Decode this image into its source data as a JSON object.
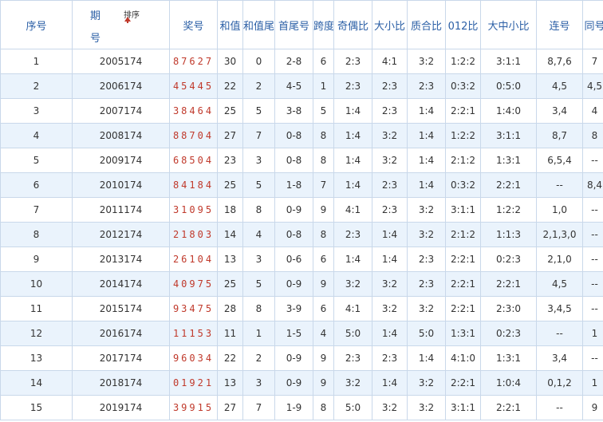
{
  "headers": {
    "index": "序号",
    "period_line1": "期",
    "period_line2": "号",
    "sort": "排序",
    "award": "奖号",
    "sum": "和值",
    "sum_tail": "和值尾",
    "first_last": "首尾号",
    "span": "跨度",
    "odd_even": "奇偶比",
    "big_small": "大小比",
    "prime_composite": "质合比",
    "mod012": "012比",
    "big_mid_small": "大中小比",
    "consecutive": "连号",
    "same": "同号"
  },
  "rows": [
    {
      "index": "1",
      "period": "2005174",
      "award": "87627",
      "sum": "30",
      "tail": "0",
      "first_last": "2-8",
      "span": "6",
      "odd_even": "2:3",
      "big_small": "4:1",
      "prime": "3:2",
      "mod012": "1:2:2",
      "bms": "3:1:1",
      "consec": "8,7,6",
      "same": "7"
    },
    {
      "index": "2",
      "period": "2006174",
      "award": "45445",
      "sum": "22",
      "tail": "2",
      "first_last": "4-5",
      "span": "1",
      "odd_even": "2:3",
      "big_small": "2:3",
      "prime": "2:3",
      "mod012": "0:3:2",
      "bms": "0:5:0",
      "consec": "4,5",
      "same": "4,5"
    },
    {
      "index": "3",
      "period": "2007174",
      "award": "38464",
      "sum": "25",
      "tail": "5",
      "first_last": "3-8",
      "span": "5",
      "odd_even": "1:4",
      "big_small": "2:3",
      "prime": "1:4",
      "mod012": "2:2:1",
      "bms": "1:4:0",
      "consec": "3,4",
      "same": "4"
    },
    {
      "index": "4",
      "period": "2008174",
      "award": "88704",
      "sum": "27",
      "tail": "7",
      "first_last": "0-8",
      "span": "8",
      "odd_even": "1:4",
      "big_small": "3:2",
      "prime": "1:4",
      "mod012": "1:2:2",
      "bms": "3:1:1",
      "consec": "8,7",
      "same": "8"
    },
    {
      "index": "5",
      "period": "2009174",
      "award": "68504",
      "sum": "23",
      "tail": "3",
      "first_last": "0-8",
      "span": "8",
      "odd_even": "1:4",
      "big_small": "3:2",
      "prime": "1:4",
      "mod012": "2:1:2",
      "bms": "1:3:1",
      "consec": "6,5,4",
      "same": "--"
    },
    {
      "index": "6",
      "period": "2010174",
      "award": "84184",
      "sum": "25",
      "tail": "5",
      "first_last": "1-8",
      "span": "7",
      "odd_even": "1:4",
      "big_small": "2:3",
      "prime": "1:4",
      "mod012": "0:3:2",
      "bms": "2:2:1",
      "consec": "--",
      "same": "8,4"
    },
    {
      "index": "7",
      "period": "2011174",
      "award": "31095",
      "sum": "18",
      "tail": "8",
      "first_last": "0-9",
      "span": "9",
      "odd_even": "4:1",
      "big_small": "2:3",
      "prime": "3:2",
      "mod012": "3:1:1",
      "bms": "1:2:2",
      "consec": "1,0",
      "same": "--"
    },
    {
      "index": "8",
      "period": "2012174",
      "award": "21803",
      "sum": "14",
      "tail": "4",
      "first_last": "0-8",
      "span": "8",
      "odd_even": "2:3",
      "big_small": "1:4",
      "prime": "3:2",
      "mod012": "2:1:2",
      "bms": "1:1:3",
      "consec": "2,1,3,0",
      "same": "--"
    },
    {
      "index": "9",
      "period": "2013174",
      "award": "26104",
      "sum": "13",
      "tail": "3",
      "first_last": "0-6",
      "span": "6",
      "odd_even": "1:4",
      "big_small": "1:4",
      "prime": "2:3",
      "mod012": "2:2:1",
      "bms": "0:2:3",
      "consec": "2,1,0",
      "same": "--"
    },
    {
      "index": "10",
      "period": "2014174",
      "award": "40975",
      "sum": "25",
      "tail": "5",
      "first_last": "0-9",
      "span": "9",
      "odd_even": "3:2",
      "big_small": "3:2",
      "prime": "2:3",
      "mod012": "2:2:1",
      "bms": "2:2:1",
      "consec": "4,5",
      "same": "--"
    },
    {
      "index": "11",
      "period": "2015174",
      "award": "93475",
      "sum": "28",
      "tail": "8",
      "first_last": "3-9",
      "span": "6",
      "odd_even": "4:1",
      "big_small": "3:2",
      "prime": "3:2",
      "mod012": "2:2:1",
      "bms": "2:3:0",
      "consec": "3,4,5",
      "same": "--"
    },
    {
      "index": "12",
      "period": "2016174",
      "award": "11153",
      "sum": "11",
      "tail": "1",
      "first_last": "1-5",
      "span": "4",
      "odd_even": "5:0",
      "big_small": "1:4",
      "prime": "5:0",
      "mod012": "1:3:1",
      "bms": "0:2:3",
      "consec": "--",
      "same": "1"
    },
    {
      "index": "13",
      "period": "2017174",
      "award": "96034",
      "sum": "22",
      "tail": "2",
      "first_last": "0-9",
      "span": "9",
      "odd_even": "2:3",
      "big_small": "2:3",
      "prime": "1:4",
      "mod012": "4:1:0",
      "bms": "1:3:1",
      "consec": "3,4",
      "same": "--"
    },
    {
      "index": "14",
      "period": "2018174",
      "award": "01921",
      "sum": "13",
      "tail": "3",
      "first_last": "0-9",
      "span": "9",
      "odd_even": "3:2",
      "big_small": "1:4",
      "prime": "3:2",
      "mod012": "2:2:1",
      "bms": "1:0:4",
      "consec": "0,1,2",
      "same": "1"
    },
    {
      "index": "15",
      "period": "2019174",
      "award": "39915",
      "sum": "27",
      "tail": "7",
      "first_last": "1-9",
      "span": "8",
      "odd_even": "5:0",
      "big_small": "3:2",
      "prime": "3:2",
      "mod012": "3:1:1",
      "bms": "2:2:1",
      "consec": "--",
      "same": "9"
    }
  ]
}
